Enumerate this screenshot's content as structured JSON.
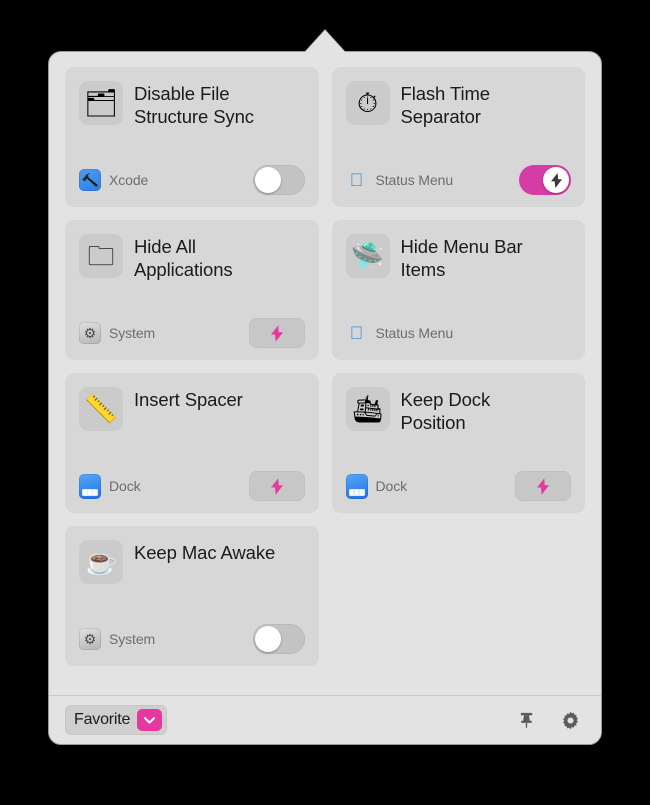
{
  "window": {
    "kind": "menubar-popover",
    "background_color": "#E3E3E3",
    "card_color": "#D7D7D7",
    "accent_color": "#D53CA6"
  },
  "cards": [
    {
      "title": "Disable File Structure Sync",
      "icon": "card-index-dividers-icon",
      "icon_glyph": "🗂",
      "app_label": "Xcode",
      "app_icon": "xcode-icon",
      "control": "toggle",
      "state": "off"
    },
    {
      "title": "Flash Time Separator",
      "icon": "stopwatch-icon",
      "icon_glyph": "⏱",
      "app_label": "Status Menu",
      "app_icon": "apple-icon",
      "control": "toggle",
      "state": "on"
    },
    {
      "title": "Hide All Applications",
      "icon": "file-folder-icon",
      "icon_glyph": "🗀",
      "app_label": "System",
      "app_icon": "system-icon",
      "control": "action",
      "state": "idle"
    },
    {
      "title": "Hide Menu Bar Items",
      "icon": "flying-saucer-icon",
      "icon_glyph": "🛸",
      "app_label": "Status Menu",
      "app_icon": "apple-icon",
      "control": "none",
      "state": ""
    },
    {
      "title": "Insert Spacer",
      "icon": "straight-ruler-icon",
      "icon_glyph": "📏",
      "app_label": "Dock",
      "app_icon": "dock-icon",
      "control": "action",
      "state": "idle"
    },
    {
      "title": "Keep Dock Position",
      "icon": "passenger-ship-icon",
      "icon_glyph": "🛳",
      "app_label": "Dock",
      "app_icon": "dock-icon",
      "control": "action",
      "state": "idle"
    },
    {
      "title": "Keep Mac Awake",
      "icon": "hot-beverage-icon",
      "icon_glyph": "☕",
      "app_label": "System",
      "app_icon": "system-icon",
      "control": "toggle",
      "state": "off"
    }
  ],
  "footer": {
    "filter_label": "Favorite",
    "filter_chevron_icon": "chevron-down-icon",
    "pin_icon": "pushpin-icon",
    "settings_icon": "gear-icon"
  }
}
